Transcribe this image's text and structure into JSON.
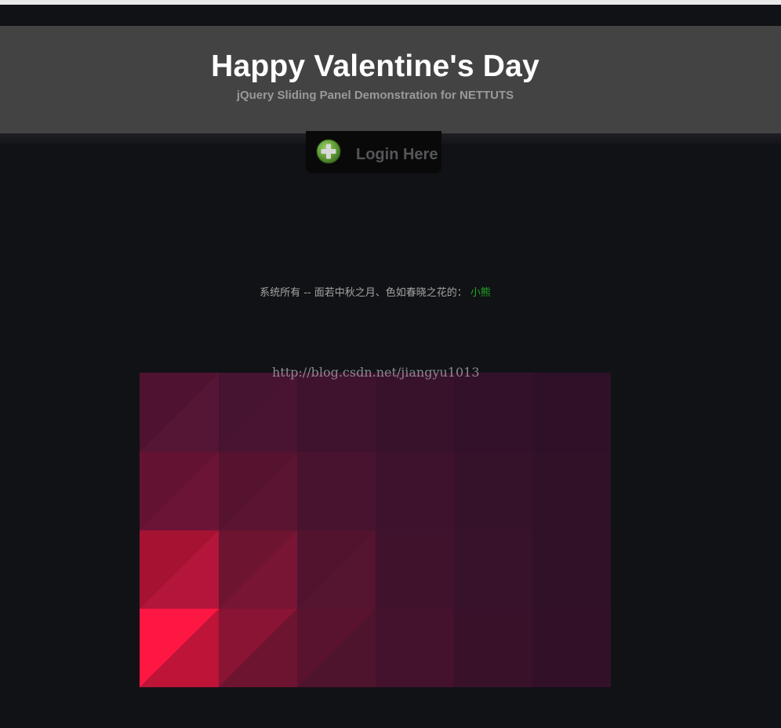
{
  "header": {
    "title": "Happy Valentine's Day",
    "subtitle": "jQuery Sliding Panel Demonstration for NETTUTS"
  },
  "login_tab": {
    "label": "Login Here",
    "icon": "plus-circle-icon"
  },
  "footer": {
    "text": "系统所有 -- 面若中秋之月、色如春晓之花的：",
    "author": "小熊"
  },
  "watermark": "http://blog.csdn.net/jiangyu1013",
  "colors": {
    "header_bg": "#434343",
    "page_bg": "#111216",
    "author_link": "#1eaa1e",
    "accent_pink": "#ff1744"
  }
}
